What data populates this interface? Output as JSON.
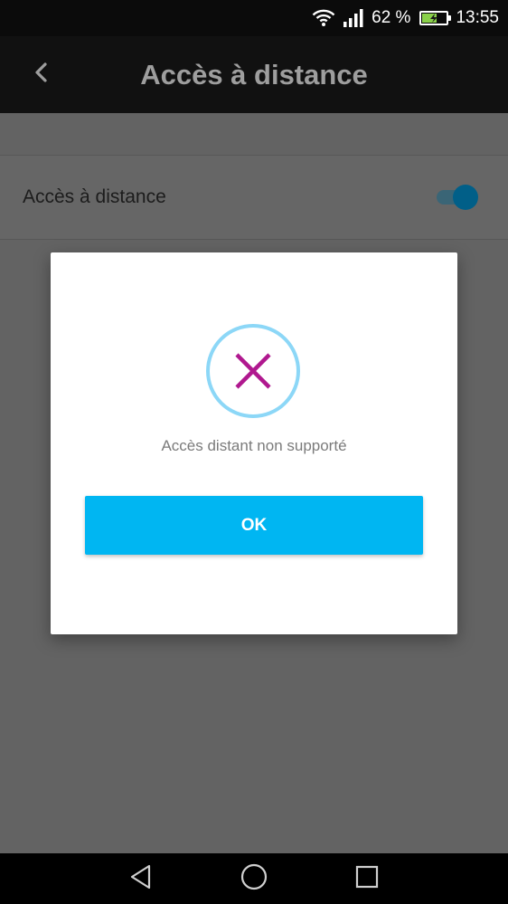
{
  "status_bar": {
    "wifi_icon": "wifi-icon",
    "signal_icon": "signal-icon",
    "battery_percent": "62 %",
    "battery_level": 0.62,
    "battery_icon": "battery-charging-icon",
    "time": "13:55"
  },
  "app_bar": {
    "back_icon": "chevron-left-icon",
    "title": "Accès à distance"
  },
  "settings": {
    "remote_access": {
      "label": "Accès à distance",
      "enabled": true
    }
  },
  "dialog": {
    "icon": "error-x-icon",
    "message": "Accès distant non supporté",
    "ok_label": "OK"
  },
  "colors": {
    "accent": "#00b6f2",
    "error_icon": "#b0188f",
    "error_ring": "#8cd7f7",
    "toggle_on": "#015f88"
  },
  "nav_bar": {
    "back_icon": "nav-back-icon",
    "home_icon": "nav-home-icon",
    "recents_icon": "nav-recents-icon"
  }
}
